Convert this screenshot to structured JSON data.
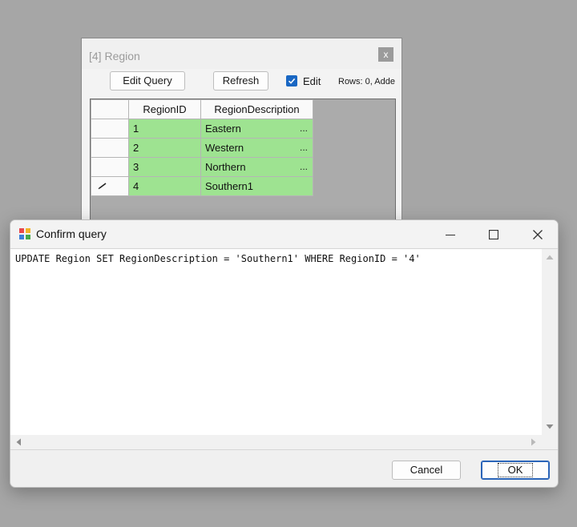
{
  "region_window": {
    "title": "[4] Region",
    "close_glyph": "x",
    "toolbar": {
      "edit_query_label": "Edit Query",
      "refresh_label": "Refresh",
      "edit_checkbox_label": "Edit",
      "edit_checked": true,
      "rows_status": "Rows: 0, Adde"
    },
    "grid": {
      "columns": [
        "RegionID",
        "RegionDescription"
      ],
      "rows": [
        {
          "id": "1",
          "desc": "Eastern",
          "ellipsis": "..."
        },
        {
          "id": "2",
          "desc": "Western",
          "ellipsis": "..."
        },
        {
          "id": "3",
          "desc": "Northern",
          "ellipsis": "..."
        },
        {
          "id": "4",
          "desc": "Southern1",
          "ellipsis": ""
        }
      ],
      "cell_color": "#9ee391"
    }
  },
  "dialog": {
    "title": "Confirm query",
    "sql": "UPDATE Region SET RegionDescription = 'Southern1' WHERE RegionID = '4'",
    "cancel_label": "Cancel",
    "ok_label": "OK"
  }
}
